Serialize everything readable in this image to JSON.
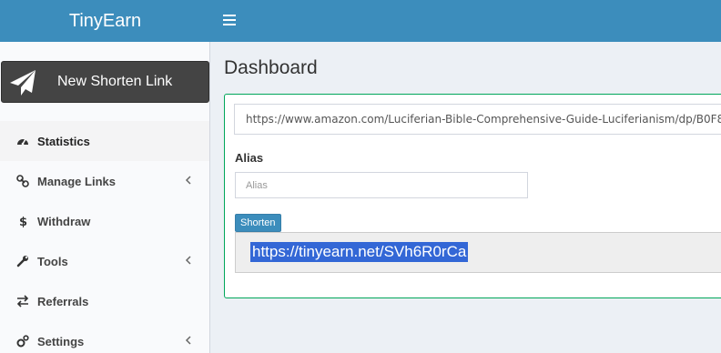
{
  "header": {
    "brand": "TinyEarn"
  },
  "sidebar": {
    "new_link_label": "New Shorten Link",
    "items": [
      {
        "label": "Statistics",
        "icon": "dashboard-icon",
        "has_chevron": false,
        "active": true
      },
      {
        "label": "Manage Links",
        "icon": "link-icon",
        "has_chevron": true,
        "active": false
      },
      {
        "label": "Withdraw",
        "icon": "dollar-icon",
        "has_chevron": false,
        "active": false
      },
      {
        "label": "Tools",
        "icon": "wrench-icon",
        "has_chevron": true,
        "active": false
      },
      {
        "label": "Referrals",
        "icon": "exchange-icon",
        "has_chevron": false,
        "active": false
      },
      {
        "label": "Settings",
        "icon": "cogs-icon",
        "has_chevron": true,
        "active": false
      }
    ]
  },
  "main": {
    "title": "Dashboard",
    "url_value": "https://www.amazon.com/Luciferian-Bible-Comprehensive-Guide-Luciferianism/dp/B0F8",
    "alias_label": "Alias",
    "alias_placeholder": "Alias",
    "shorten_label": "Shorten",
    "result_url": "https://tinyearn.net/SVh6R0rCa"
  },
  "colors": {
    "header": "#3c8dbc",
    "box_border": "#00a65a",
    "selection": "#3367d6"
  }
}
